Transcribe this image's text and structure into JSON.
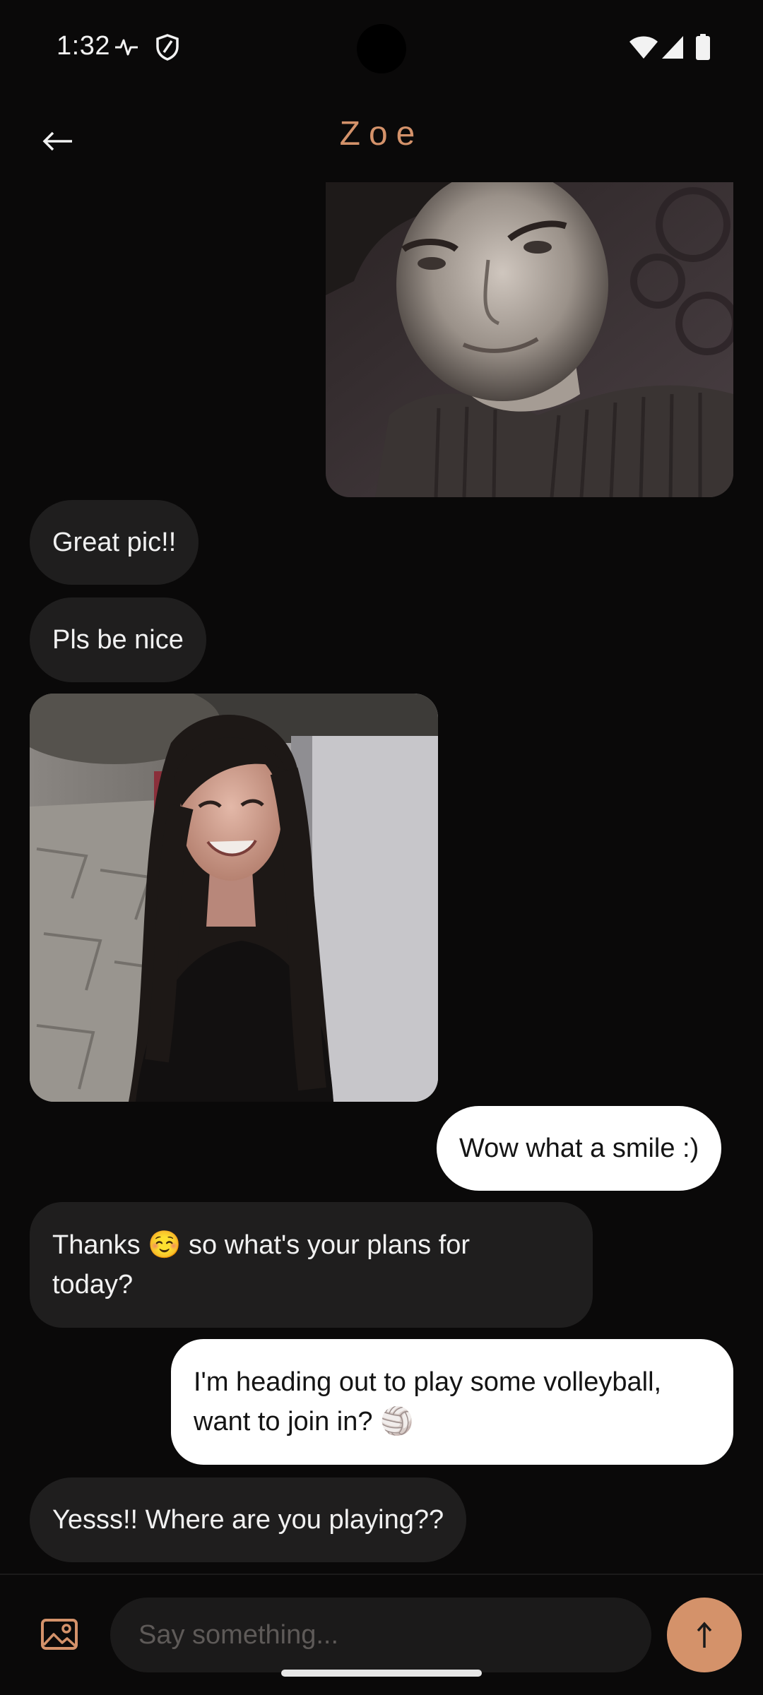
{
  "status_bar": {
    "time": "1:32",
    "icons": [
      "activity-icon",
      "shield-icon",
      "wifi-icon",
      "signal-icon",
      "battery-icon"
    ]
  },
  "header": {
    "back_icon": "arrow-left-icon",
    "title": "Zoe"
  },
  "messages": [
    {
      "type": "photo",
      "direction": "outgoing",
      "subject": "man-portrait"
    },
    {
      "type": "text",
      "direction": "incoming",
      "text": "Great pic!!"
    },
    {
      "type": "text",
      "direction": "incoming",
      "text": "Pls be nice"
    },
    {
      "type": "photo",
      "direction": "incoming",
      "subject": "woman-portrait"
    },
    {
      "type": "text",
      "direction": "outgoing",
      "text": "Wow what a smile :)"
    },
    {
      "type": "text",
      "direction": "incoming",
      "line1": "Thanks ☺️ so what's your plans for",
      "line2": "today?"
    },
    {
      "type": "text",
      "direction": "outgoing",
      "line1": "I'm heading out to play some volleyball,",
      "line2": "want to join in? 🏐"
    },
    {
      "type": "text",
      "direction": "incoming",
      "text": "Yesss!! Where are you playing??"
    }
  ],
  "composer": {
    "gallery_icon": "image-icon",
    "placeholder": "Say something...",
    "value": "",
    "send_icon": "arrow-up-icon"
  },
  "colors": {
    "background": "#0a0909",
    "accent": "#d4926a",
    "incoming_bubble": "#1f1e1e",
    "outgoing_bubble": "#ffffff"
  }
}
